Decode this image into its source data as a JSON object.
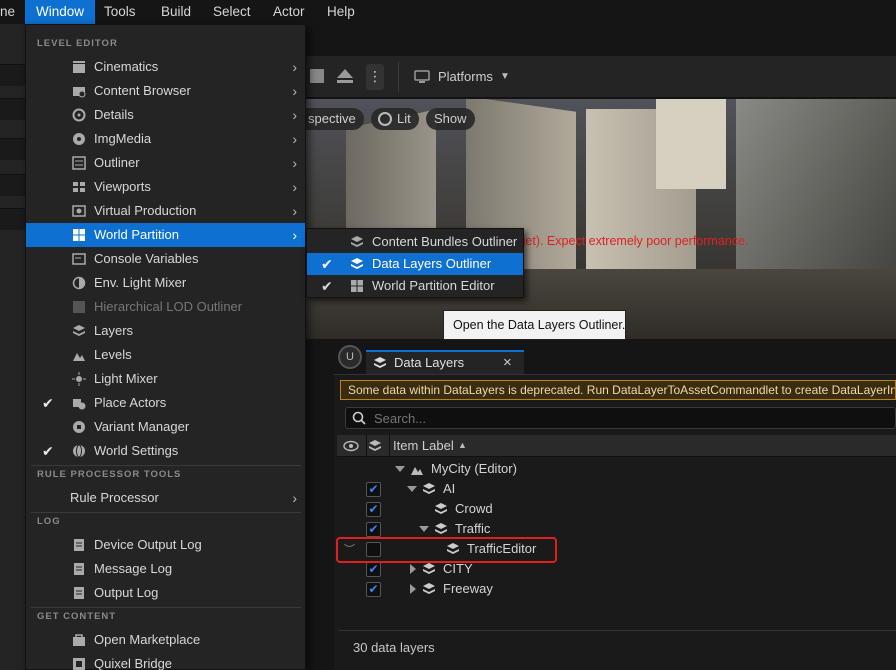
{
  "menubar": {
    "items": [
      "ne",
      "Window",
      "Tools",
      "Build",
      "Select",
      "Actor",
      "Help"
    ],
    "active": "Window"
  },
  "window_menu": {
    "sections": {
      "level_editor": "LEVEL EDITOR",
      "rule_processor_tools": "RULE PROCESSOR TOOLS",
      "log": "LOG",
      "get_content": "GET CONTENT"
    },
    "level_editor_items": [
      {
        "label": "Cinematics",
        "icon": "film-icon",
        "submenu": true,
        "checked": false,
        "disabled": false,
        "highlighted": false
      },
      {
        "label": "Content Browser",
        "icon": "folder-icon",
        "submenu": true,
        "checked": false,
        "disabled": false,
        "highlighted": false
      },
      {
        "label": "Details",
        "icon": "details-icon",
        "submenu": true,
        "checked": false,
        "disabled": false,
        "highlighted": false
      },
      {
        "label": "ImgMedia",
        "icon": "media-icon",
        "submenu": true,
        "checked": false,
        "disabled": false,
        "highlighted": false
      },
      {
        "label": "Outliner",
        "icon": "outliner-icon",
        "submenu": true,
        "checked": false,
        "disabled": false,
        "highlighted": false
      },
      {
        "label": "Viewports",
        "icon": "viewports-icon",
        "submenu": true,
        "checked": false,
        "disabled": false,
        "highlighted": false
      },
      {
        "label": "Virtual Production",
        "icon": "camera-icon",
        "submenu": true,
        "checked": false,
        "disabled": false,
        "highlighted": false
      },
      {
        "label": "World Partition",
        "icon": "world-partition-icon",
        "submenu": true,
        "checked": false,
        "disabled": false,
        "highlighted": true
      },
      {
        "label": "Console Variables",
        "icon": "console-icon",
        "submenu": false,
        "checked": false,
        "disabled": false,
        "highlighted": false
      },
      {
        "label": "Env. Light Mixer",
        "icon": "light-mixer-icon",
        "submenu": false,
        "checked": false,
        "disabled": false,
        "highlighted": false
      },
      {
        "label": "Hierarchical LOD Outliner",
        "icon": "hlod-icon",
        "submenu": false,
        "checked": false,
        "disabled": true,
        "highlighted": false
      },
      {
        "label": "Layers",
        "icon": "layers-icon",
        "submenu": false,
        "checked": false,
        "disabled": false,
        "highlighted": false
      },
      {
        "label": "Levels",
        "icon": "levels-icon",
        "submenu": false,
        "checked": false,
        "disabled": false,
        "highlighted": false
      },
      {
        "label": "Light Mixer",
        "icon": "light-icon",
        "submenu": false,
        "checked": false,
        "disabled": false,
        "highlighted": false
      },
      {
        "label": "Place Actors",
        "icon": "place-actors-icon",
        "submenu": false,
        "checked": true,
        "disabled": false,
        "highlighted": false
      },
      {
        "label": "Variant Manager",
        "icon": "variant-icon",
        "submenu": false,
        "checked": false,
        "disabled": false,
        "highlighted": false
      },
      {
        "label": "World Settings",
        "icon": "globe-icon",
        "submenu": false,
        "checked": true,
        "disabled": false,
        "highlighted": false
      }
    ],
    "rule_items": [
      {
        "label": "Rule Processor",
        "submenu": true
      }
    ],
    "log_items": [
      {
        "label": "Device Output Log",
        "icon": "log-icon"
      },
      {
        "label": "Message Log",
        "icon": "log-icon"
      },
      {
        "label": "Output Log",
        "icon": "log-icon"
      }
    ],
    "content_items": [
      {
        "label": "Open Marketplace",
        "icon": "marketplace-icon"
      },
      {
        "label": "Quixel Bridge",
        "icon": "bridge-icon"
      }
    ]
  },
  "world_partition_submenu": [
    {
      "label": "Content Bundles Outliner",
      "checked": false,
      "highlighted": false
    },
    {
      "label": "Data Layers Outliner",
      "checked": true,
      "highlighted": true
    },
    {
      "label": "World Partition Editor",
      "checked": true,
      "highlighted": false
    }
  ],
  "tooltip": "Open the Data Layers Outliner.",
  "toolbar": {
    "platforms_label": "Platforms"
  },
  "viewport": {
    "buttons": [
      "spective",
      "Lit",
      "Show"
    ],
    "warning": "er budget). Expect extremely poor performance."
  },
  "data_layers": {
    "tab_label": "Data Layers",
    "close_glyph": "×",
    "deprecation_notice": "Some data within DataLayers is deprecated. Run DataLayerToAssetCommandlet to create DataLayerInstances",
    "search_placeholder": "Search...",
    "column_header": "Item Label",
    "sort_glyph": "▲",
    "rows": [
      {
        "label": "MyCity (Editor)",
        "depth": 0,
        "expanded": true,
        "checkbox": false,
        "checked": false,
        "kind": "world"
      },
      {
        "label": "AI",
        "depth": 1,
        "expanded": true,
        "checkbox": true,
        "checked": true,
        "kind": "layer"
      },
      {
        "label": "Crowd",
        "depth": 2,
        "expanded": false,
        "checkbox": true,
        "checked": true,
        "kind": "layer"
      },
      {
        "label": "Traffic",
        "depth": 2,
        "expanded": true,
        "checkbox": true,
        "checked": true,
        "kind": "layer"
      },
      {
        "label": "TrafficEditor",
        "depth": 3,
        "expanded": false,
        "checkbox": true,
        "checked": false,
        "kind": "layer"
      },
      {
        "label": "CITY",
        "depth": 1,
        "expanded": false,
        "checkbox": true,
        "checked": true,
        "kind": "layer"
      },
      {
        "label": "Freeway",
        "depth": 1,
        "expanded": false,
        "checkbox": true,
        "checked": true,
        "kind": "layer"
      }
    ],
    "footer": "30 data layers"
  },
  "colors": {
    "accent": "#0e70d0",
    "highlight_box": "#e02020",
    "warning_text": "#e02020"
  }
}
